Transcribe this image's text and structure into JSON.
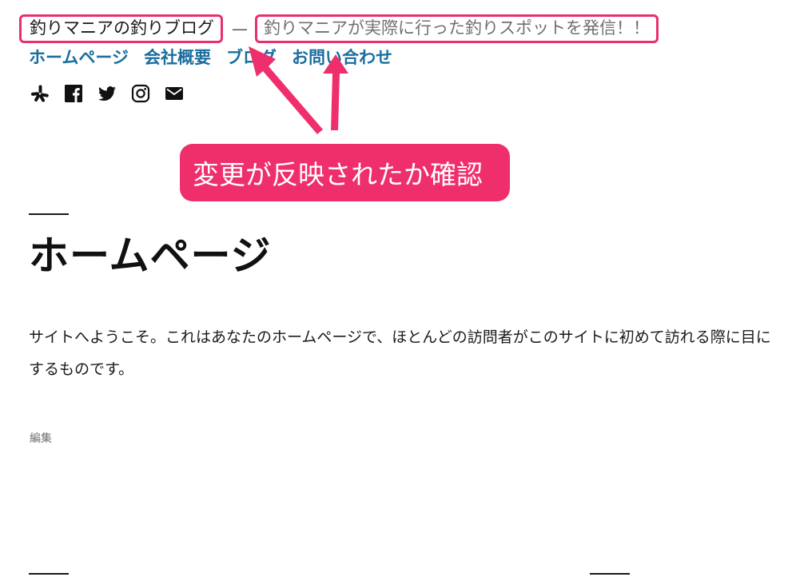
{
  "header": {
    "site_title": "釣りマニアの釣りブログ",
    "separator": "—",
    "tagline": "釣りマニアが実際に行った釣りスポットを発信！！"
  },
  "nav": {
    "items": [
      {
        "label": "ホームページ"
      },
      {
        "label": "会社概要"
      },
      {
        "label": "ブログ"
      },
      {
        "label": "お問い合わせ"
      }
    ]
  },
  "social": {
    "icons": [
      "yelp-icon",
      "facebook-icon",
      "twitter-icon",
      "instagram-icon",
      "mail-icon"
    ]
  },
  "annotation": {
    "text": "変更が反映されたか確認",
    "color": "#ef2f6b"
  },
  "page": {
    "title": "ホームページ",
    "content": "サイトへようこそ。これはあなたのホームページで、ほとんどの訪問者がこのサイトに初めて訪れる際に目にするものです。",
    "edit_label": "編集"
  },
  "colors": {
    "link": "#1a6e9e",
    "highlight_border": "#e8306b",
    "tagline_text": "#707070"
  }
}
